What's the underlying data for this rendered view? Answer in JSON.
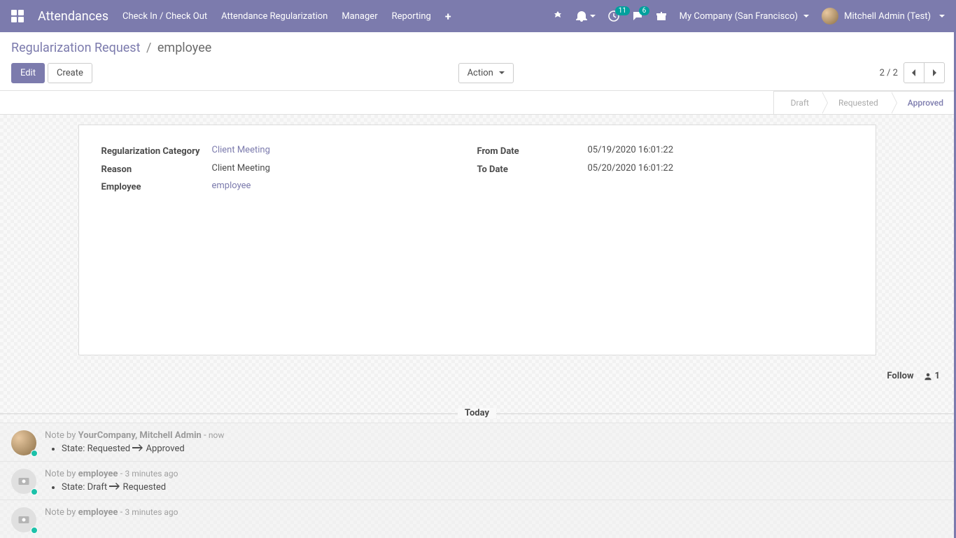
{
  "topbar": {
    "brand": "Attendances",
    "nav": [
      "Check In / Check Out",
      "Attendance Regularization",
      "Manager",
      "Reporting"
    ],
    "plus_label": "+",
    "badges": {
      "clock": "11",
      "chat": "6"
    },
    "company": "My Company (San Francisco)",
    "user": "Mitchell Admin (Test)"
  },
  "breadcrumb": {
    "parent": "Regularization Request",
    "current": "employee",
    "sep": "/"
  },
  "buttons": {
    "edit": "Edit",
    "create": "Create",
    "action": "Action"
  },
  "pager": "2 / 2",
  "status": {
    "draft": "Draft",
    "requested": "Requested",
    "approved": "Approved"
  },
  "fields": {
    "reg_cat_label": "Regularization Category",
    "reg_cat_value": "Client Meeting",
    "reason_label": "Reason",
    "reason_value": "Client Meeting",
    "employee_label": "Employee",
    "employee_value": "employee",
    "from_label": "From Date",
    "from_value": "05/19/2020 16:01:22",
    "to_label": "To Date",
    "to_value": "05/20/2020 16:01:22"
  },
  "follow": {
    "label": "Follow",
    "count": "1"
  },
  "chatter": {
    "today": "Today",
    "note_prefix": "Note by ",
    "msgs": [
      {
        "author": "YourCompany, Mitchell Admin",
        "time": "now",
        "state_label": "State:",
        "from": "Requested",
        "to": "Approved",
        "avatar": "real"
      },
      {
        "author": "employee",
        "time": "3 minutes ago",
        "state_label": "State:",
        "from": "Draft",
        "to": "Requested",
        "avatar": "placeholder"
      },
      {
        "author": "employee",
        "time": "3 minutes ago",
        "state_label": "",
        "from": "",
        "to": "",
        "avatar": "placeholder"
      }
    ]
  }
}
